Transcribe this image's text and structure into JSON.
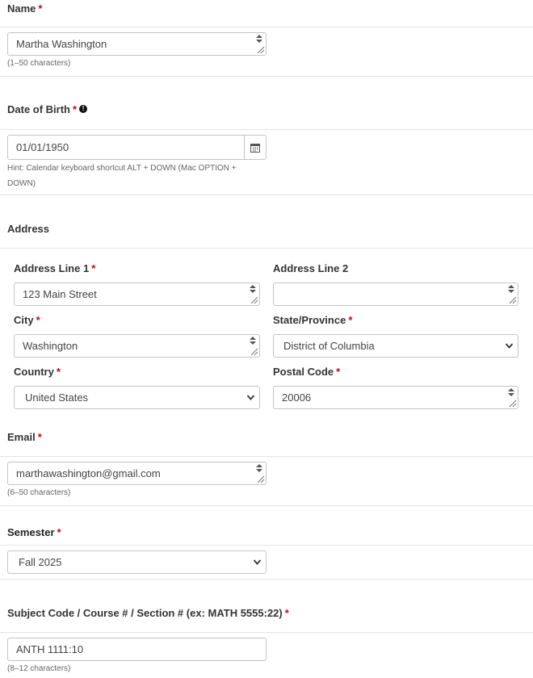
{
  "required_mark": "*",
  "name": {
    "label": "Name",
    "value": "Martha Washington",
    "hint": "(1–50 characters)"
  },
  "dob": {
    "label": "Date of Birth",
    "info_icon": "info-icon",
    "value": "01/01/1950",
    "hint_line1": "Hint: Calendar keyboard shortcut ALT + DOWN (Mac OPTION +",
    "hint_line2": "DOWN)",
    "calendar_icon": "calendar-icon"
  },
  "address": {
    "heading": "Address",
    "line1": {
      "label": "Address Line 1",
      "value": "123 Main Street"
    },
    "line2": {
      "label": "Address Line 2",
      "value": ""
    },
    "city": {
      "label": "City",
      "value": "Washington"
    },
    "state": {
      "label": "State/Province",
      "value": "District of Columbia"
    },
    "country": {
      "label": "Country",
      "value": "United States"
    },
    "postal": {
      "label": "Postal Code",
      "value": "20006"
    }
  },
  "email": {
    "label": "Email",
    "value": "marthawashington@gmail.com",
    "hint": "(6–50 characters)"
  },
  "semester": {
    "label": "Semester",
    "value": "Fall 2025"
  },
  "subject": {
    "label": "Subject Code / Course # / Section # (ex: MATH 5555:22)",
    "value": "ANTH 1111:10",
    "hint": "(8–12 characters)"
  },
  "colors": {
    "required": "#d0021b",
    "border": "#c4c4c4",
    "divider": "#e4e4e4"
  }
}
